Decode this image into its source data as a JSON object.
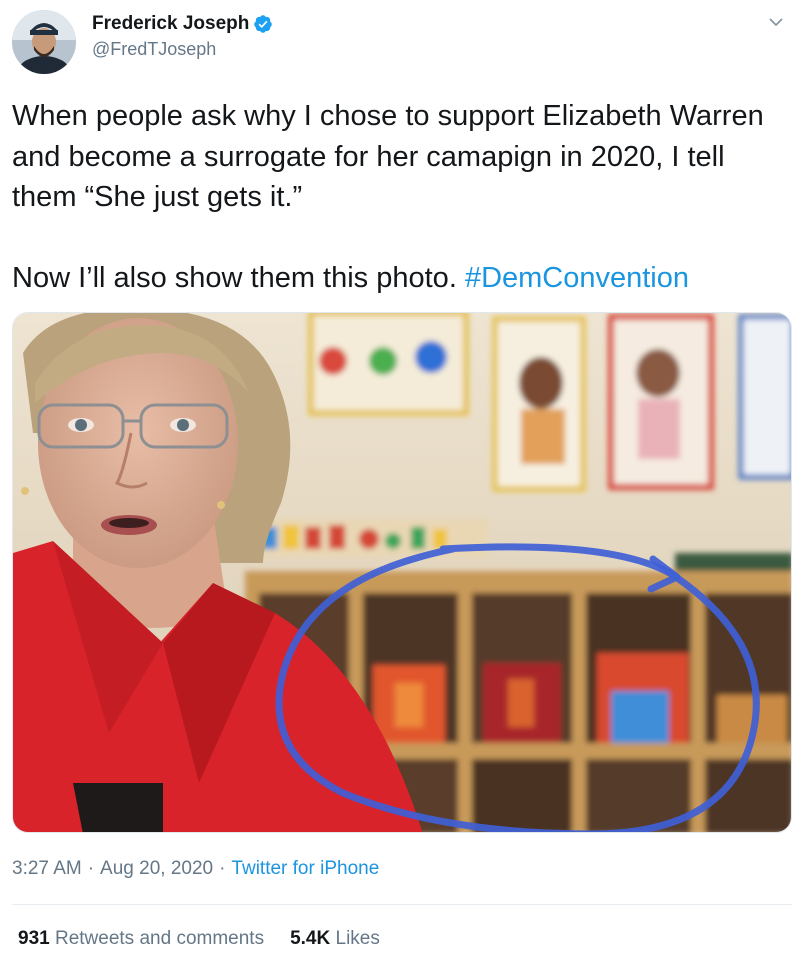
{
  "author": {
    "display_name": "Frederick Joseph",
    "handle": "@FredTJoseph"
  },
  "tweet": {
    "paragraph1": "When people ask why I chose to support Elizabeth Warren and become a surrogate for her camapign in 2020, I tell them “She just gets it.”",
    "paragraph2_text": "Now I’ll also show them this photo. ",
    "hashtag": "#DemConvention"
  },
  "meta": {
    "time": "3:27 AM",
    "date": "Aug 20, 2020",
    "separator": "·",
    "source": "Twitter for iPhone"
  },
  "stats": {
    "retweets_count": "931",
    "retweets_label": "Retweets and comments",
    "likes_count": "5.4K",
    "likes_label": "Likes"
  },
  "icons": {
    "verified": "verified-badge-icon",
    "caret": "chevron-down-icon"
  },
  "colors": {
    "link": "#1b95e0",
    "verified": "#1da1f2",
    "secondary_text": "#657786"
  }
}
